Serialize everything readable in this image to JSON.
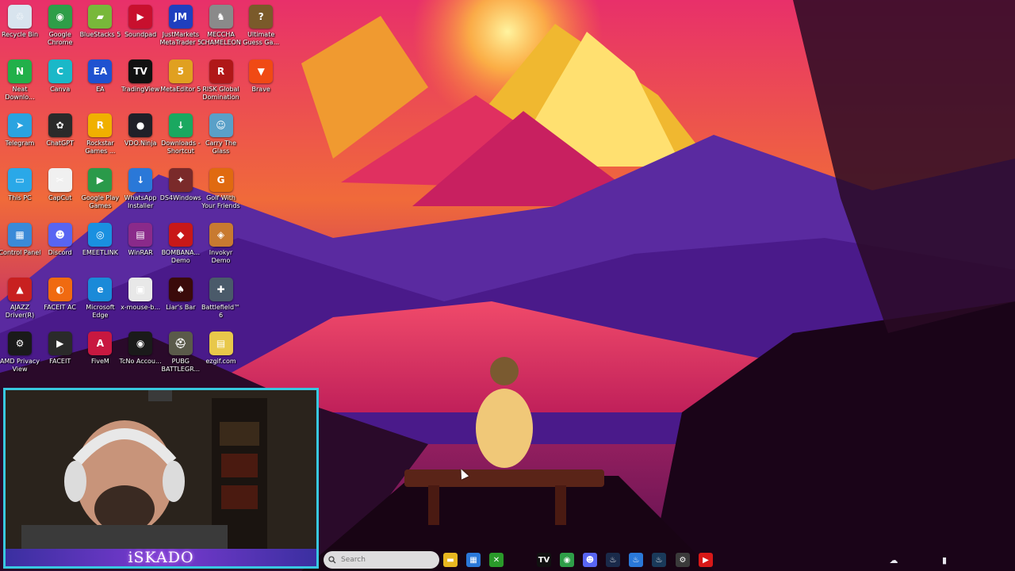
{
  "desktop": {
    "icons": [
      {
        "label": "Recycle Bin",
        "icon": "recycle-bin-icon",
        "color": "#d8e4ee",
        "glyph": "♲",
        "col": 0,
        "row": 0
      },
      {
        "label": "Google Chrome",
        "icon": "chrome-icon",
        "color": "#2e9e48",
        "glyph": "◉",
        "col": 1,
        "row": 0
      },
      {
        "label": "BlueStacks 5",
        "icon": "bluestacks-icon",
        "color": "#78b83a",
        "glyph": "▰",
        "col": 2,
        "row": 0
      },
      {
        "label": "Soundpad",
        "icon": "soundpad-icon",
        "color": "#c8102e",
        "glyph": "▶",
        "col": 3,
        "row": 0
      },
      {
        "label": "JustMarkets MetaTrader 5",
        "icon": "justmarkets-icon",
        "color": "#1f3fbf",
        "glyph": "JM",
        "col": 4,
        "row": 0
      },
      {
        "label": "MECCHA CHAMELEON",
        "icon": "meccha-chameleon-icon",
        "color": "#8a8a8a",
        "glyph": "♞",
        "col": 5,
        "row": 0
      },
      {
        "label": "Ultimate Guess Ga...",
        "icon": "ultimate-guess-icon",
        "color": "#7a5a2a",
        "glyph": "?",
        "col": 6,
        "row": 0
      },
      {
        "label": "Neat Downlo...",
        "icon": "neat-download-icon",
        "color": "#22b04a",
        "glyph": "N",
        "col": 0,
        "row": 1
      },
      {
        "label": "Canva",
        "icon": "canva-icon",
        "color": "#1ab8c8",
        "glyph": "C",
        "col": 1,
        "row": 1
      },
      {
        "label": "EA",
        "icon": "ea-icon",
        "color": "#1f52d0",
        "glyph": "EA",
        "col": 2,
        "row": 1
      },
      {
        "label": "TradingView",
        "icon": "tradingview-icon",
        "color": "#111111",
        "glyph": "TV",
        "col": 3,
        "row": 1
      },
      {
        "label": "MetaEditor 5",
        "icon": "metaeditor-icon",
        "color": "#e0a020",
        "glyph": "5",
        "col": 4,
        "row": 1
      },
      {
        "label": "RISK Global Domination",
        "icon": "risk-icon",
        "color": "#b01818",
        "glyph": "R",
        "col": 5,
        "row": 1
      },
      {
        "label": "Brave",
        "icon": "brave-icon",
        "color": "#f04a14",
        "glyph": "▼",
        "col": 6,
        "row": 1
      },
      {
        "label": "Telegram",
        "icon": "telegram-icon",
        "color": "#2aa3e0",
        "glyph": "➤",
        "col": 0,
        "row": 2
      },
      {
        "label": "ChatGPT",
        "icon": "chatgpt-icon",
        "color": "#2a2a2a",
        "glyph": "✿",
        "col": 1,
        "row": 2
      },
      {
        "label": "Rockstar Games ...",
        "icon": "rockstar-icon",
        "color": "#f0b000",
        "glyph": "R",
        "col": 2,
        "row": 2
      },
      {
        "label": "VDO.Ninja",
        "icon": "vdo-ninja-icon",
        "color": "#202028",
        "glyph": "●",
        "col": 3,
        "row": 2
      },
      {
        "label": "Downloads - Shortcut",
        "icon": "downloads-folder-icon",
        "color": "#1aa860",
        "glyph": "↓",
        "col": 4,
        "row": 2
      },
      {
        "label": "Carry The Glass",
        "icon": "carry-glass-icon",
        "color": "#5aa0c8",
        "glyph": "☺",
        "col": 5,
        "row": 2
      },
      {
        "label": "This PC",
        "icon": "this-pc-icon",
        "color": "#2aa8e8",
        "glyph": "▭",
        "col": 0,
        "row": 3
      },
      {
        "label": "CapCut",
        "icon": "capcut-icon",
        "color": "#f0f0f0",
        "glyph": "✂",
        "col": 1,
        "row": 3
      },
      {
        "label": "Google Play Games",
        "icon": "google-play-games-icon",
        "color": "#2a9a4a",
        "glyph": "▶",
        "col": 2,
        "row": 3
      },
      {
        "label": "WhatsApp Installer",
        "icon": "whatsapp-installer-icon",
        "color": "#2a78d8",
        "glyph": "↓",
        "col": 3,
        "row": 3
      },
      {
        "label": "DS4Windows",
        "icon": "ds4windows-icon",
        "color": "#7a2a2a",
        "glyph": "✦",
        "col": 4,
        "row": 3
      },
      {
        "label": "Golf With Your Friends",
        "icon": "golf-friends-icon",
        "color": "#e06a10",
        "glyph": "G",
        "col": 5,
        "row": 3
      },
      {
        "label": "Control Panel",
        "icon": "control-panel-icon",
        "color": "#3a8ad8",
        "glyph": "▦",
        "col": 0,
        "row": 4
      },
      {
        "label": "Discord",
        "icon": "discord-icon",
        "color": "#5865f2",
        "glyph": "☻",
        "col": 1,
        "row": 4
      },
      {
        "label": "EMEETLINK",
        "icon": "emeetlink-icon",
        "color": "#1a90e0",
        "glyph": "◎",
        "col": 2,
        "row": 4
      },
      {
        "label": "WinRAR",
        "icon": "winrar-icon",
        "color": "#8a2a8a",
        "glyph": "▤",
        "col": 3,
        "row": 4
      },
      {
        "label": "BOMBANA... Demo",
        "icon": "bombana-icon",
        "color": "#c81818",
        "glyph": "◆",
        "col": 4,
        "row": 4
      },
      {
        "label": "Invokyr Demo",
        "icon": "invokyr-icon",
        "color": "#c87a30",
        "glyph": "◈",
        "col": 5,
        "row": 4
      },
      {
        "label": "AJAZZ Driver(R)",
        "icon": "ajazz-icon",
        "color": "#c82020",
        "glyph": "▲",
        "col": 0,
        "row": 5
      },
      {
        "label": "FACEIT AC",
        "icon": "faceit-ac-icon",
        "color": "#f06a10",
        "glyph": "◐",
        "col": 1,
        "row": 5
      },
      {
        "label": "Microsoft Edge",
        "icon": "edge-icon",
        "color": "#1a8ad8",
        "glyph": "e",
        "col": 2,
        "row": 5
      },
      {
        "label": "x-mouse-b...",
        "icon": "x-mouse-icon",
        "color": "#e8e8e8",
        "glyph": "▣",
        "col": 3,
        "row": 5
      },
      {
        "label": "Liar's Bar",
        "icon": "liars-bar-icon",
        "color": "#3a0a0a",
        "glyph": "♠",
        "col": 4,
        "row": 5
      },
      {
        "label": "Battlefield™ 6",
        "icon": "battlefield-icon",
        "color": "#4a5a6a",
        "glyph": "✚",
        "col": 5,
        "row": 5
      },
      {
        "label": "AMD Privacy View",
        "icon": "amd-privacy-icon",
        "color": "#1a1a1a",
        "glyph": "⚙",
        "col": 0,
        "row": 6
      },
      {
        "label": "FACEIT",
        "icon": "faceit-icon",
        "color": "#2a2a2a",
        "glyph": "▶",
        "col": 1,
        "row": 6
      },
      {
        "label": "FiveM",
        "icon": "fivem-icon",
        "color": "#c81840",
        "glyph": "A",
        "col": 2,
        "row": 6
      },
      {
        "label": "TcNo Accou...",
        "icon": "tcno-icon",
        "color": "#1a1a1a",
        "glyph": "◉",
        "col": 3,
        "row": 6
      },
      {
        "label": "PUBG BATTLEGR...",
        "icon": "pubg-icon",
        "color": "#5a5a4a",
        "glyph": "⛑",
        "col": 4,
        "row": 6
      },
      {
        "label": "ezgif.com",
        "icon": "ezgif-icon",
        "color": "#e8c84a",
        "glyph": "▤",
        "col": 5,
        "row": 6
      }
    ]
  },
  "webcam": {
    "title": "iSKADO",
    "accent": "#38c8e0"
  },
  "taskbar": {
    "search_placeholder": "Search",
    "search_icon": "search-icon",
    "pinned": [
      {
        "icon": "file-explorer-icon",
        "color": "#e8b820",
        "glyph": "▬"
      },
      {
        "icon": "store-icon",
        "color": "#2a78d8",
        "glyph": "▦"
      },
      {
        "icon": "xbox-icon",
        "color": "#2a9a2a",
        "glyph": "✕"
      },
      {
        "icon": "tradingview-taskbar-icon",
        "color": "#111111",
        "glyph": "TV"
      },
      {
        "icon": "chrome-taskbar-icon",
        "color": "#2e9e48",
        "glyph": "◉"
      },
      {
        "icon": "discord-taskbar-icon",
        "color": "#5865f2",
        "glyph": "☻"
      },
      {
        "icon": "steam-taskbar-icon",
        "color": "#1a2a4a",
        "glyph": "♨"
      },
      {
        "icon": "steam-alt-taskbar-icon",
        "color": "#2a78d8",
        "glyph": "♨"
      },
      {
        "icon": "steam-third-taskbar-icon",
        "color": "#1a3a5a",
        "glyph": "♨"
      },
      {
        "icon": "settings-taskbar-icon",
        "color": "#3a3a3a",
        "glyph": "⚙"
      },
      {
        "icon": "youtube-taskbar-icon",
        "color": "#d81818",
        "glyph": "▶"
      }
    ],
    "tray": [
      {
        "icon": "cloud-tray-icon",
        "glyph": "☁"
      },
      {
        "icon": "microphone-tray-icon",
        "glyph": "▮"
      }
    ]
  }
}
